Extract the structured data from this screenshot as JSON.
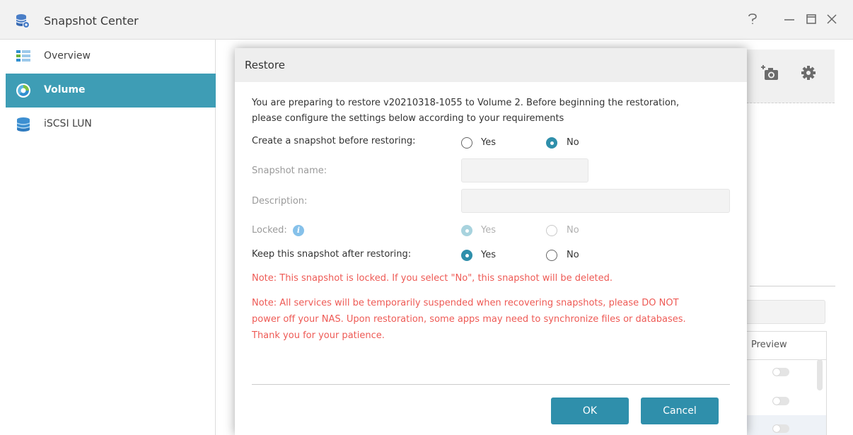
{
  "window": {
    "title": "Snapshot Center",
    "controls": [
      "help",
      "minimize",
      "maximize",
      "close"
    ]
  },
  "sidebar": {
    "items": [
      {
        "label": "Overview",
        "icon": "overview-icon",
        "active": false
      },
      {
        "label": "Volume",
        "icon": "volume-icon",
        "active": true
      },
      {
        "label": "iSCSI LUN",
        "icon": "database-icon",
        "active": false
      }
    ]
  },
  "background": {
    "preview_header": "Preview",
    "toolbar_icons": [
      "add-snapshot-icon",
      "settings-icon"
    ]
  },
  "dialog": {
    "title": "Restore",
    "intro_line1": "You are preparing to restore v20210318-1055 to Volume 2. Before beginning the restoration,",
    "intro_line2": "please configure the settings below according to your requirements",
    "create_snapshot_label": "Create a snapshot before restoring:",
    "create_snapshot_options": {
      "yes": "Yes",
      "no": "No",
      "selected": "No"
    },
    "snapshot_name_label": "Snapshot name:",
    "snapshot_name_value": "",
    "description_label": "Description:",
    "description_value": "",
    "locked_label": "Locked:",
    "locked_options": {
      "yes": "Yes",
      "no": "No",
      "selected": "Yes",
      "disabled": true
    },
    "keep_snapshot_label": "Keep this snapshot after restoring:",
    "keep_snapshot_options": {
      "yes": "Yes",
      "no": "No",
      "selected": "Yes"
    },
    "note1": "Note: This snapshot is locked. If you select \"No\", this snapshot will be deleted.",
    "note2_line1": "Note: All services will be temporarily suspended when recovering snapshots, please DO NOT",
    "note2_line2": "power off your NAS. Upon restoration, some apps may need to synchronize files or databases.",
    "note2_line3": "Thank you for your patience.",
    "ok_label": "OK",
    "cancel_label": "Cancel"
  },
  "colors": {
    "accent": "#2f8fab",
    "sidebar_active": "#3e9db5",
    "note_red": "#ee5a55"
  }
}
